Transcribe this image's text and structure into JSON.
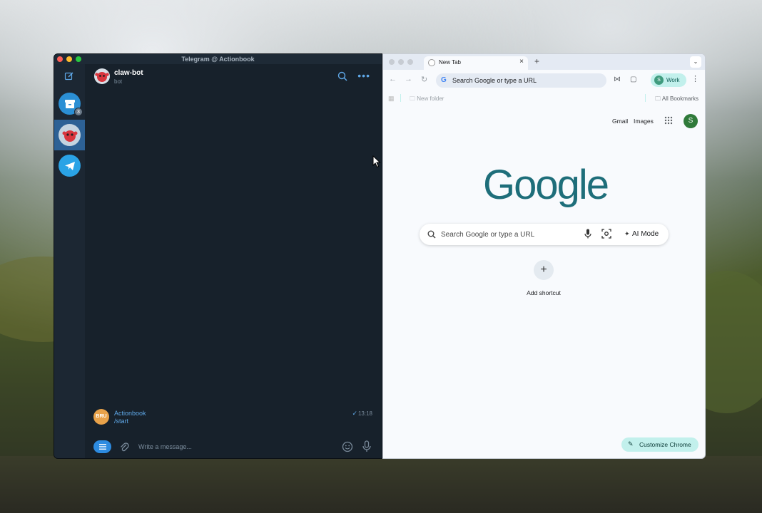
{
  "telegram": {
    "window_title": "Telegram @ Actionbook",
    "sidebar": {
      "archive_badge": "3"
    },
    "header": {
      "chat_name": "claw-bot",
      "chat_status": "bot"
    },
    "messages": [
      {
        "sender": "Actionbook",
        "text": "/start",
        "time": "13:18",
        "avatar_text": "BRU",
        "status_icon": "double-check-icon"
      }
    ],
    "composer": {
      "placeholder": "Write a message..."
    },
    "colors": {
      "background": "#17212b",
      "accent": "#5fa8e8"
    }
  },
  "chrome": {
    "tab": {
      "title": "New Tab"
    },
    "omnibox": {
      "placeholder": "Search Google or type a URL"
    },
    "profile": {
      "initial": "S",
      "label": "Work"
    },
    "bookmarks_bar": {
      "folder": "New folder",
      "all_bookmarks": "All Bookmarks"
    },
    "ntp": {
      "links": {
        "gmail": "Gmail",
        "images": "Images"
      },
      "avatar_initial": "S",
      "logo": "Google",
      "search_placeholder": "Search Google or type a URL",
      "ai_mode_label": "AI Mode",
      "add_shortcut_label": "Add shortcut",
      "customize_label": "Customize Chrome"
    },
    "colors": {
      "chip": "#c2f0ec",
      "logo": "#1e6e7a"
    }
  }
}
